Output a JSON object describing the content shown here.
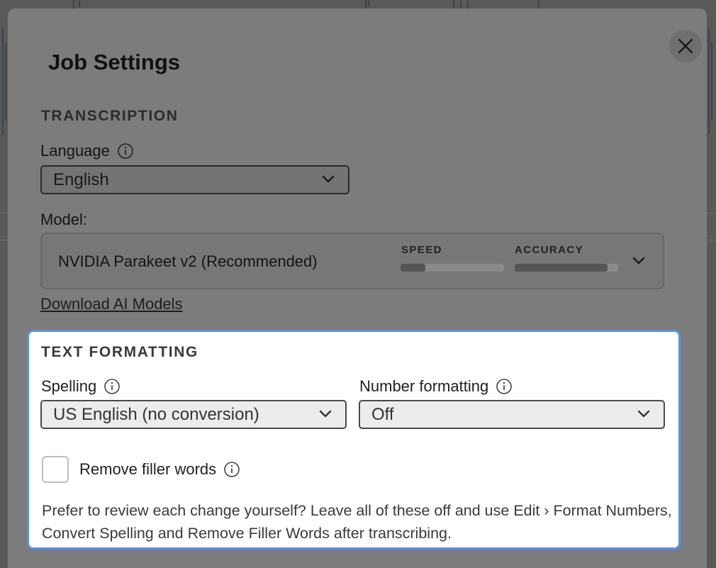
{
  "dialog": {
    "title": "Job Settings",
    "close_icon": "close-icon"
  },
  "transcription": {
    "heading": "TRANSCRIPTION",
    "language_label": "Language",
    "language_value": "English",
    "model_label": "Model:",
    "model": {
      "name": "NVIDIA Parakeet v2 (Recommended)",
      "speed_label": "SPEED",
      "speed_level": 0.24,
      "accuracy_label": "ACCURACY",
      "accuracy_level": 0.9
    },
    "download_link": "Download AI Models"
  },
  "text_formatting": {
    "heading": "TEXT FORMATTING",
    "spelling_label": "Spelling",
    "spelling_value": "US English (no conversion)",
    "number_formatting_label": "Number formatting",
    "number_formatting_value": "Off",
    "remove_filler_label": "Remove filler words",
    "remove_filler_checked": false,
    "note": "Prefer to review each change yourself? Leave all of these off and use Edit › Format Numbers, Convert Spelling and Remove Filler Words after transcribing."
  },
  "colors": {
    "highlight_border": "#5b8fe6",
    "overlay": "#595959"
  }
}
